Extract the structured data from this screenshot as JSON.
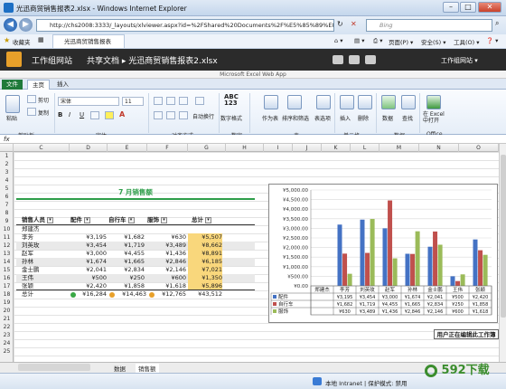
{
  "window": {
    "title": "光迅商贸销售报表2.xlsx - Windows Internet Explorer",
    "min": "–",
    "max": "□",
    "close": "✕"
  },
  "address": {
    "url": "http://chs2008:3333/_layouts/xlviewer.aspx?id=%2FShared%20Documents%2F%E5%85%89%E8%BF%85%",
    "search": "Bing"
  },
  "favorites": {
    "label": "收藏夹",
    "tab": "光迅商贸销售报表2.xlsx",
    "page": "页面(P) ▾",
    "safety": "安全(S) ▾",
    "tools": "工具(O) ▾",
    "help": "❓ ▾"
  },
  "sharepoint": {
    "site": "工作组网站",
    "breadcrumb": "共享文档 ▸ 光迅商贸销售报表2.xlsx",
    "user": "工作组网站 ▾",
    "app": "Microsoft Excel Web App"
  },
  "ribbon": {
    "tabs": [
      "文件",
      "主页",
      "插入"
    ],
    "clipboard": {
      "paste": "粘贴",
      "cut": "剪切",
      "copy": "复制",
      "group": "剪贴板"
    },
    "font": {
      "name": "宋体",
      "size": "11",
      "group": "字体",
      "bold": "B",
      "italic": "I",
      "underline": "U",
      "color": "A"
    },
    "align": {
      "wrap": "自动换行",
      "group": "对齐方式"
    },
    "number": {
      "format": "数字格式",
      "group": "数字",
      "sample": "ABC\n123"
    },
    "tables": {
      "table": "作为表",
      "sort": "排序和筛选",
      "options": "表选项",
      "group": "表"
    },
    "cells": {
      "insert": "插入",
      "delete": "删除",
      "group": "单元格"
    },
    "data": {
      "data": "数据",
      "find": "查找",
      "group": "数据"
    },
    "office": {
      "open": "在 Excel\n中打开",
      "group": "Office"
    }
  },
  "formula": {
    "fx": "fx"
  },
  "columns": [
    "C",
    "D",
    "E",
    "F",
    "G",
    "H",
    "I",
    "J",
    "K",
    "L",
    "M",
    "N",
    "O"
  ],
  "rows": [
    "1",
    "2",
    "3",
    "4",
    "5",
    "6",
    "7",
    "8",
    "9",
    "10",
    "11",
    "12",
    "13",
    "14",
    "15",
    "16",
    "17",
    "18",
    "19",
    "20",
    "21",
    "22",
    "23",
    "24",
    "25"
  ],
  "sheet": {
    "title": "7 月销售额",
    "headers": [
      "销售人员",
      "配件",
      "自行车",
      "服饰",
      "总计"
    ],
    "group_label": "郑建杰",
    "data": [
      {
        "name": "李芳",
        "a": "¥3,195",
        "b": "¥1,682",
        "c": "¥630",
        "t": "¥5,507"
      },
      {
        "name": "刘英玫",
        "a": "¥3,454",
        "b": "¥1,719",
        "c": "¥3,489",
        "t": "¥8,662"
      },
      {
        "name": "赵军",
        "a": "¥3,000",
        "b": "¥4,455",
        "c": "¥1,436",
        "t": "¥8,891"
      },
      {
        "name": "孙林",
        "a": "¥1,674",
        "b": "¥1,665",
        "c": "¥2,846",
        "t": "¥6,185"
      },
      {
        "name": "金士鹏",
        "a": "¥2,041",
        "b": "¥2,834",
        "c": "¥2,146",
        "t": "¥7,021"
      },
      {
        "name": "王伟",
        "a": "¥500",
        "b": "¥250",
        "c": "¥600",
        "t": "¥1,350"
      },
      {
        "name": "张颖",
        "a": "¥2,420",
        "b": "¥1,858",
        "c": "¥1,618",
        "t": "¥5,896"
      }
    ],
    "total": {
      "name": "总计",
      "a": "¥16,284",
      "b": "¥14,463",
      "c": "¥12,765",
      "t": "¥43,512"
    }
  },
  "chart_data": {
    "type": "bar",
    "categories": [
      "郑建杰",
      "李芳",
      "刘英玫",
      "赵军",
      "孙林",
      "金士鹏",
      "王伟",
      "张颖"
    ],
    "series": [
      {
        "name": "配件",
        "color": "#4472c4",
        "values": [
          0,
          3195,
          3454,
          3000,
          1674,
          2041,
          500,
          2420
        ]
      },
      {
        "name": "自行车",
        "color": "#c0504d",
        "values": [
          0,
          1682,
          1719,
          4455,
          1665,
          2834,
          250,
          1858
        ]
      },
      {
        "name": "服饰",
        "color": "#9bbb59",
        "values": [
          0,
          630,
          3489,
          1436,
          2846,
          2146,
          600,
          1618
        ]
      }
    ],
    "ylim": [
      0,
      5000
    ],
    "yticks": [
      "¥5,000.00",
      "¥4,500.00",
      "¥4,000.00",
      "¥3,500.00",
      "¥3,000.00",
      "¥2,500.00",
      "¥2,000.00",
      "¥1,500.00",
      "¥1,000.00",
      "¥500.00",
      "¥0.00"
    ],
    "table_rows": [
      {
        "name": "配件",
        "cells": [
          "",
          "¥3,195",
          "¥3,454",
          "¥3,000",
          "¥1,674",
          "¥2,041",
          "¥500",
          "¥2,420"
        ]
      },
      {
        "name": "自行车",
        "cells": [
          "",
          "¥1,682",
          "¥1,719",
          "¥4,455",
          "¥1,665",
          "¥2,834",
          "¥250",
          "¥1,858"
        ]
      },
      {
        "name": "服饰",
        "cells": [
          "",
          "¥630",
          "¥3,489",
          "¥1,436",
          "¥2,846",
          "¥2,146",
          "¥600",
          "¥1,618"
        ]
      }
    ]
  },
  "tooltip": "用户正在编辑此工作簿",
  "sheettabs": [
    "数据",
    "销售额"
  ],
  "status": {
    "zone": "本地 Intranet | 保护模式: 禁用"
  },
  "watermark": "592下载"
}
